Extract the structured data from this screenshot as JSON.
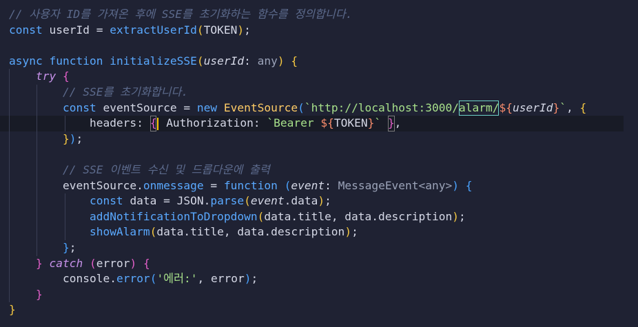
{
  "colors": {
    "background": "#1f2233",
    "comment": "#5c6a8c",
    "keyword": "#5aa9ff",
    "keyword_flow": "#c792ea",
    "function": "#5aa9ff",
    "variable": "#d5d8e6",
    "type": "#9ba3b8",
    "string": "#a7e08a",
    "brace_yellow": "#f5c842",
    "brace_pink": "#e25fc8",
    "brace_blue": "#4aa3ff",
    "punct": "#d5d8e6",
    "class_name": "#ffcc66",
    "property_method": "#5aa9ff",
    "template_interp": "#f78c6c"
  },
  "code": {
    "lines": [
      [
        {
          "t": "// 사용자 ID를 가져온 후에 SSE를 초기화하는 함수를 정의합니다.",
          "c": "comment",
          "i": true
        }
      ],
      [
        {
          "t": "const ",
          "c": "keyword"
        },
        {
          "t": "userId",
          "c": "variable"
        },
        {
          "t": " = ",
          "c": "punct"
        },
        {
          "t": "extractUserId",
          "c": "function"
        },
        {
          "t": "(",
          "c": "brace_yellow"
        },
        {
          "t": "TOKEN",
          "c": "variable"
        },
        {
          "t": ")",
          "c": "brace_yellow"
        },
        {
          "t": ";",
          "c": "punct"
        }
      ],
      [],
      [
        {
          "t": "async ",
          "c": "keyword"
        },
        {
          "t": "function ",
          "c": "keyword"
        },
        {
          "t": "initializeSSE",
          "c": "function"
        },
        {
          "t": "(",
          "c": "brace_yellow"
        },
        {
          "t": "userId",
          "c": "variable",
          "i": true
        },
        {
          "t": ": ",
          "c": "punct"
        },
        {
          "t": "any",
          "c": "type"
        },
        {
          "t": ") ",
          "c": "brace_yellow"
        },
        {
          "t": "{",
          "c": "brace_yellow"
        }
      ],
      [
        {
          "t": "    "
        },
        {
          "t": "try",
          "c": "keyword_flow",
          "i": true
        },
        {
          "t": " "
        },
        {
          "t": "{",
          "c": "brace_pink"
        }
      ],
      [
        {
          "t": "        "
        },
        {
          "t": "// SSE를 초기화합니다.",
          "c": "comment",
          "i": true
        }
      ],
      [
        {
          "t": "        "
        },
        {
          "t": "const ",
          "c": "keyword"
        },
        {
          "t": "eventSource",
          "c": "variable"
        },
        {
          "t": " = ",
          "c": "punct"
        },
        {
          "t": "new ",
          "c": "keyword"
        },
        {
          "t": "EventSource",
          "c": "class_name"
        },
        {
          "t": "(",
          "c": "brace_blue"
        },
        {
          "t": "`http://localhost:3000/",
          "c": "string"
        },
        {
          "t": "alarm/",
          "c": "string",
          "box": true
        },
        {
          "t": "${",
          "c": "template_interp"
        },
        {
          "t": "userId",
          "c": "variable",
          "i": true
        },
        {
          "t": "}",
          "c": "template_interp"
        },
        {
          "t": "`",
          "c": "string"
        },
        {
          "t": ", ",
          "c": "punct"
        },
        {
          "t": "{",
          "c": "brace_yellow"
        }
      ],
      [
        {
          "t": "            "
        },
        {
          "t": "headers",
          "c": "variable"
        },
        {
          "t": ": ",
          "c": "punct"
        },
        {
          "t": "{",
          "c": "brace_pink",
          "bbox": true
        },
        {
          "t": " ",
          "cursor": true
        },
        {
          "t": "Authorization",
          "c": "variable"
        },
        {
          "t": ": ",
          "c": "punct"
        },
        {
          "t": "`Bearer ",
          "c": "string"
        },
        {
          "t": "${",
          "c": "template_interp"
        },
        {
          "t": "TOKEN",
          "c": "variable"
        },
        {
          "t": "}",
          "c": "template_interp"
        },
        {
          "t": "`",
          "c": "string"
        },
        {
          "t": " "
        },
        {
          "t": "}",
          "c": "brace_pink",
          "bbox": true
        },
        {
          "t": ",",
          "c": "punct"
        }
      ],
      [
        {
          "t": "        "
        },
        {
          "t": "}",
          "c": "brace_yellow"
        },
        {
          "t": ")",
          "c": "brace_blue"
        },
        {
          "t": ";",
          "c": "punct"
        }
      ],
      [],
      [
        {
          "t": "        "
        },
        {
          "t": "// SSE 이벤트 수신 및 드롭다운에 출력",
          "c": "comment",
          "i": true
        }
      ],
      [
        {
          "t": "        "
        },
        {
          "t": "eventSource",
          "c": "variable"
        },
        {
          "t": ".",
          "c": "punct"
        },
        {
          "t": "onmessage",
          "c": "property_method"
        },
        {
          "t": " = ",
          "c": "punct"
        },
        {
          "t": "function ",
          "c": "keyword"
        },
        {
          "t": "(",
          "c": "brace_blue"
        },
        {
          "t": "event",
          "c": "variable",
          "i": true
        },
        {
          "t": ": ",
          "c": "punct"
        },
        {
          "t": "MessageEvent<any>",
          "c": "type"
        },
        {
          "t": ") ",
          "c": "brace_blue"
        },
        {
          "t": "{",
          "c": "brace_blue"
        }
      ],
      [
        {
          "t": "            "
        },
        {
          "t": "const ",
          "c": "keyword"
        },
        {
          "t": "data",
          "c": "variable"
        },
        {
          "t": " = ",
          "c": "punct"
        },
        {
          "t": "JSON",
          "c": "variable"
        },
        {
          "t": ".",
          "c": "punct"
        },
        {
          "t": "parse",
          "c": "property_method"
        },
        {
          "t": "(",
          "c": "brace_yellow"
        },
        {
          "t": "event",
          "c": "variable",
          "i": true
        },
        {
          "t": ".data",
          "c": "variable"
        },
        {
          "t": ")",
          "c": "brace_yellow"
        },
        {
          "t": ";",
          "c": "punct"
        }
      ],
      [
        {
          "t": "            "
        },
        {
          "t": "addNotificationToDropdown",
          "c": "function"
        },
        {
          "t": "(",
          "c": "brace_yellow"
        },
        {
          "t": "data.title, data.description",
          "c": "variable"
        },
        {
          "t": ")",
          "c": "brace_yellow"
        },
        {
          "t": ";",
          "c": "punct"
        }
      ],
      [
        {
          "t": "            "
        },
        {
          "t": "showAlarm",
          "c": "function"
        },
        {
          "t": "(",
          "c": "brace_yellow"
        },
        {
          "t": "data.title, data.description",
          "c": "variable"
        },
        {
          "t": ")",
          "c": "brace_yellow"
        },
        {
          "t": ";",
          "c": "punct"
        }
      ],
      [
        {
          "t": "        "
        },
        {
          "t": "}",
          "c": "brace_blue"
        },
        {
          "t": ";",
          "c": "punct"
        }
      ],
      [
        {
          "t": "    "
        },
        {
          "t": "} ",
          "c": "brace_pink"
        },
        {
          "t": "catch",
          "c": "keyword_flow",
          "i": true
        },
        {
          "t": " "
        },
        {
          "t": "(",
          "c": "brace_pink"
        },
        {
          "t": "error",
          "c": "variable"
        },
        {
          "t": ") ",
          "c": "brace_pink"
        },
        {
          "t": "{",
          "c": "brace_pink"
        }
      ],
      [
        {
          "t": "        "
        },
        {
          "t": "console",
          "c": "variable"
        },
        {
          "t": ".",
          "c": "punct"
        },
        {
          "t": "error",
          "c": "property_method"
        },
        {
          "t": "(",
          "c": "brace_blue"
        },
        {
          "t": "'에러:'",
          "c": "string"
        },
        {
          "t": ", error",
          "c": "variable"
        },
        {
          "t": ")",
          "c": "brace_blue"
        },
        {
          "t": ";",
          "c": "punct"
        }
      ],
      [
        {
          "t": "    "
        },
        {
          "t": "}",
          "c": "brace_pink"
        }
      ],
      [
        {
          "t": "}",
          "c": "brace_yellow"
        }
      ]
    ]
  }
}
